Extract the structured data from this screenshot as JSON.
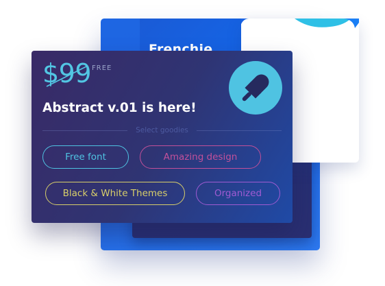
{
  "back_card": {
    "title": "Frenchie"
  },
  "front_card": {
    "price": "$99",
    "price_note": "FREE",
    "headline": "Abstract v.01 is here!",
    "divider_label": "Select goodies",
    "badge_icon": "popsicle-icon"
  },
  "goodies": [
    {
      "label": "Free font",
      "color": "#4fc3e2"
    },
    {
      "label": "Amazing design",
      "color": "#c2509a"
    },
    {
      "label": "Black & White Themes",
      "color": "#d8cf6a"
    },
    {
      "label": "Organized",
      "color": "#a05bd3"
    }
  ],
  "colors": {
    "accent_cyan": "#52c6e3",
    "back_blue": "#1e66e3",
    "front_purple": "#392a66",
    "icon_dark": "#262a5e"
  }
}
